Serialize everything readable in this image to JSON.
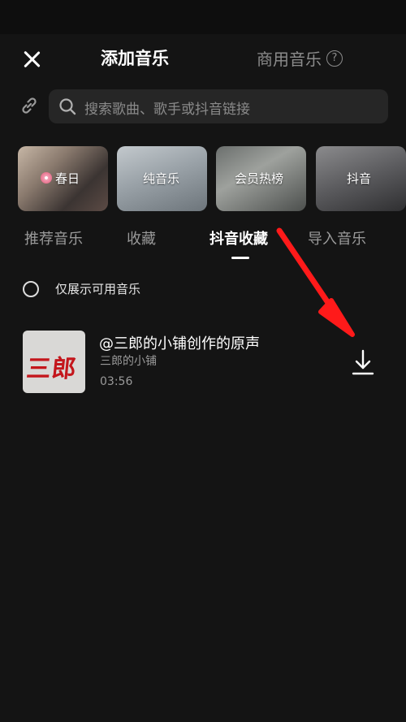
{
  "header": {
    "title": "添加音乐",
    "commercial_label": "商用音乐",
    "help_glyph": "?"
  },
  "search": {
    "placeholder": "搜索歌曲、歌手或抖音链接"
  },
  "categories": [
    {
      "label": "春日",
      "icon": "flower-icon"
    },
    {
      "label": "纯音乐"
    },
    {
      "label": "会员热榜"
    },
    {
      "label": "抖音"
    }
  ],
  "tabs": [
    {
      "label": "推荐音乐",
      "active": false
    },
    {
      "label": "收藏",
      "active": false
    },
    {
      "label": "抖音收藏",
      "active": true
    },
    {
      "label": "导入音乐",
      "active": false
    }
  ],
  "filter": {
    "label": "仅展示可用音乐",
    "checked": false
  },
  "songs": [
    {
      "cover_text": "三郎",
      "title": "@三郎的小铺创作的原声",
      "artist": "三郎的小铺",
      "duration": "03:56",
      "action_icon": "download-icon"
    }
  ],
  "colors": {
    "background": "#141414",
    "search_bg": "#262626",
    "muted_text": "#9a9a9a",
    "annotation_arrow": "#ff1a1a",
    "cover_text": "#c4161c"
  }
}
